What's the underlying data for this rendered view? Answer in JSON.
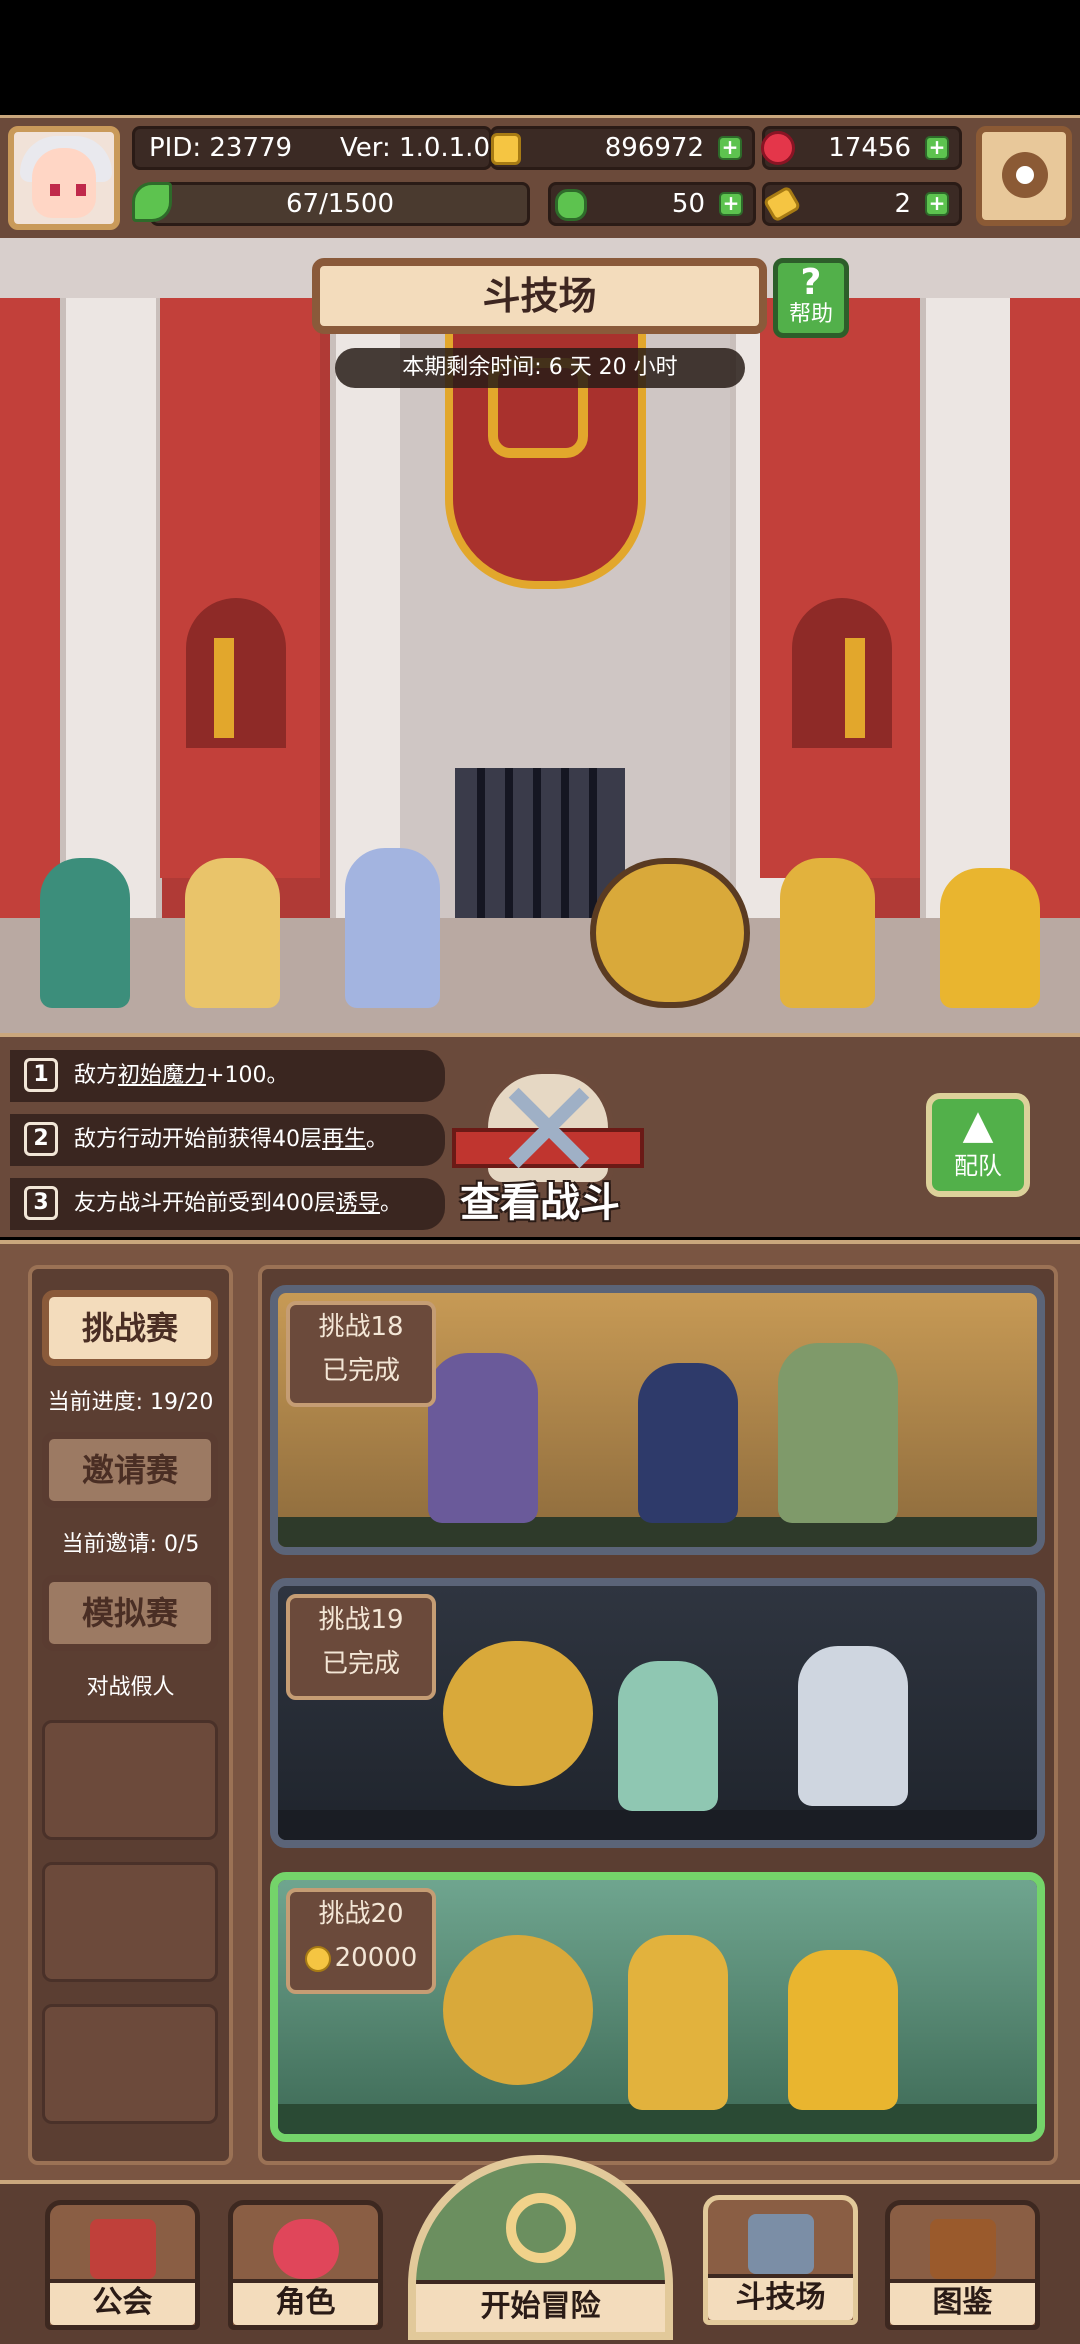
{
  "player": {
    "pid": "PID: 23779",
    "version": "Ver: 1.0.1.0",
    "stamina": "67/1500"
  },
  "resources": {
    "gold": "896972",
    "gems": "17456",
    "clover": "50",
    "key": "2"
  },
  "arena": {
    "title": "斗技场",
    "help_label": "帮助",
    "help_icon": "?",
    "timer": "本期剩余时间: 6 天 20 小时"
  },
  "rules": [
    {
      "num": "1",
      "pre": "敌方",
      "em": "初始魔力",
      "post": "+100。"
    },
    {
      "num": "2",
      "pre": "敌方行动开始前获得40层",
      "em": "再生",
      "post": "。"
    },
    {
      "num": "3",
      "pre": "友方战斗开始前受到400层",
      "em": "诱导",
      "post": "。"
    }
  ],
  "actions": {
    "view_battle": "查看战斗",
    "team": "配队"
  },
  "modes": [
    {
      "label": "挑战赛",
      "sub": "当前进度: 19/20"
    },
    {
      "label": "邀请赛",
      "sub": "当前邀请: 0/5"
    },
    {
      "label": "模拟赛",
      "sub": "对战假人"
    }
  ],
  "challenges": [
    {
      "name": "挑战18",
      "status": "已完成"
    },
    {
      "name": "挑战19",
      "status": "已完成"
    },
    {
      "name": "挑战20",
      "reward": "20000"
    }
  ],
  "nav": {
    "guild": "公会",
    "character": "角色",
    "start": "开始冒险",
    "arena": "斗技场",
    "codex": "图鉴"
  },
  "colors": {
    "accent_green": "#52b04a",
    "panel_brown": "#5b3e32",
    "frame_gold": "#caa77d"
  }
}
